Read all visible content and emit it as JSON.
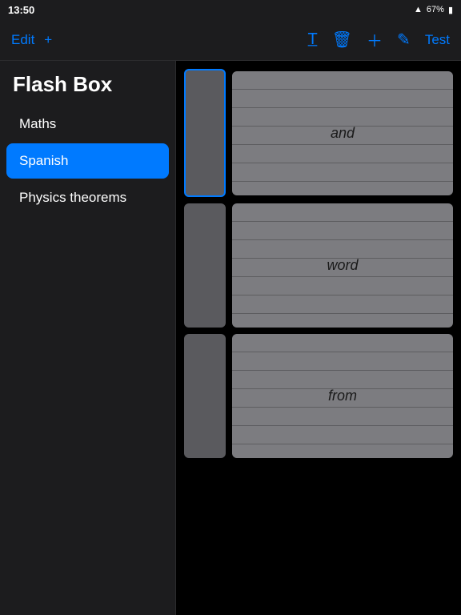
{
  "statusBar": {
    "time": "13:50",
    "wifi": "wifi",
    "battery": "67%"
  },
  "header": {
    "editLabel": "Edit",
    "addLabel": "+",
    "testLabel": "Test"
  },
  "appTitle": "Flash Box",
  "sidebar": {
    "items": [
      {
        "id": "maths",
        "label": "Maths",
        "active": false
      },
      {
        "id": "spanish",
        "label": "Spanish",
        "active": true
      },
      {
        "id": "physics",
        "label": "Physics theorems",
        "active": false
      }
    ]
  },
  "cards": [
    {
      "id": "card1",
      "text": "and"
    },
    {
      "id": "card2",
      "text": "word"
    },
    {
      "id": "card3",
      "text": "from"
    }
  ]
}
